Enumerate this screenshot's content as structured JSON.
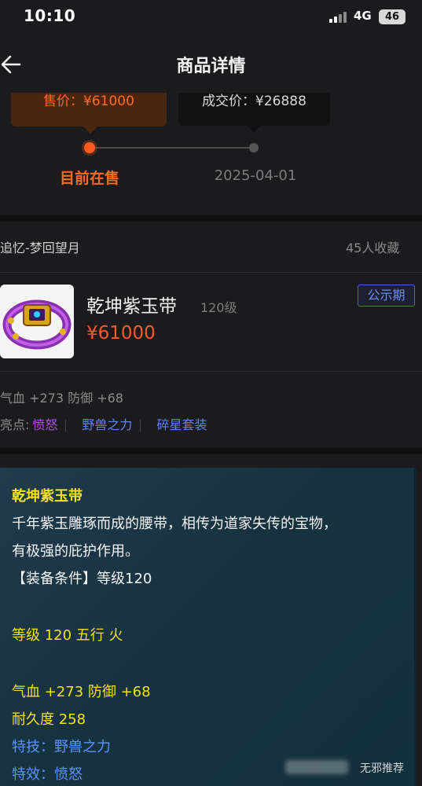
{
  "status_bar": {
    "time": "10:10",
    "network": "4G",
    "battery": "46"
  },
  "header": {
    "title": "商品详情",
    "back_icon": "arrow-left-icon"
  },
  "price_timeline": {
    "sale_price_label": "售价：¥61000",
    "deal_price_label": "成交价：¥26888",
    "current_label": "目前在售",
    "past_date": "2025-04-01"
  },
  "item": {
    "server": "追忆-梦回望月",
    "favorites": "45人收藏",
    "name": "乾坤紫玉带",
    "level": "120级",
    "price": "¥61000",
    "badge": "公示期",
    "stats": "气血 +273 防御 +68",
    "highlights_label": "亮点:",
    "highlights": [
      "愤怒",
      "野兽之力",
      "碎星套装"
    ]
  },
  "tooltip": {
    "title": "乾坤紫玉带",
    "desc_line1": "千年紫玉雕琢而成的腰带，相传为道家失传的宝物，",
    "desc_line2": "有极强的庇护作用。",
    "requirement": "【装备条件】等级120",
    "level_element": "等级 120 五行 火",
    "attrs": "气血 +273 防御 +68",
    "durability": "耐久度 258",
    "skill": "特技：野兽之力",
    "effect": "特效：愤怒"
  },
  "watermark": "无邪推荐",
  "colors": {
    "accent": "#ff5a1e",
    "tooltip_yellow": "#f2e21a",
    "link_blue": "#5a86f2",
    "purple": "#b14fe0"
  }
}
